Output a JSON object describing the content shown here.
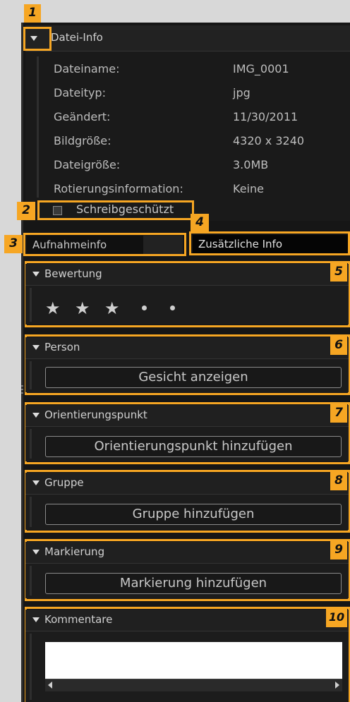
{
  "callouts": [
    "1",
    "2",
    "3",
    "4",
    "5",
    "6",
    "7",
    "8",
    "9",
    "10"
  ],
  "file_info": {
    "header": "Datei-Info",
    "rows": [
      {
        "label": "Dateiname:",
        "value": "IMG_0001"
      },
      {
        "label": "Dateityp:",
        "value": "jpg"
      },
      {
        "label": "Geändert:",
        "value": "11/30/2011"
      },
      {
        "label": "Bildgröße:",
        "value": "4320 x 3240"
      },
      {
        "label": "Dateigröße:",
        "value": "3.0MB"
      },
      {
        "label": "Rotierungsinformation:",
        "value": "Keine"
      }
    ],
    "write_protect_label": "Schreibgeschützt"
  },
  "tabs": {
    "capture_info": "Aufnahmeinfo",
    "extra_info": "Zusätzliche Info"
  },
  "rating": {
    "header": "Bewertung",
    "stars": 3,
    "max": 5
  },
  "person": {
    "header": "Person",
    "button": "Gesicht anzeigen"
  },
  "landmark": {
    "header": "Orientierungspunkt",
    "button": "Orientierungspunkt hinzufügen"
  },
  "group": {
    "header": "Gruppe",
    "button": "Gruppe hinzufügen"
  },
  "tag": {
    "header": "Markierung",
    "button": "Markierung hinzufügen"
  },
  "comments": {
    "header": "Kommentare",
    "value": ""
  },
  "colors": {
    "callout": "#f6a623",
    "panel": "#161616",
    "page": "#d8d8d8"
  }
}
